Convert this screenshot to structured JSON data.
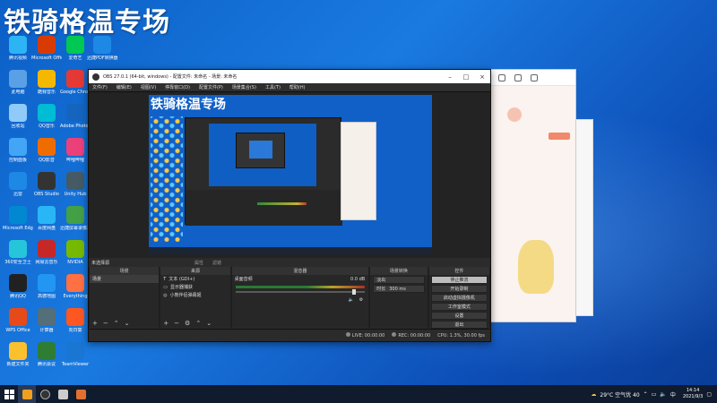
{
  "overlay_title": "铁骑格温专场",
  "desktop_icons": [
    {
      "label": "腾讯视频"
    },
    {
      "label": "Microsoft Office"
    },
    {
      "label": "爱奇艺"
    },
    {
      "label": "迅捷PDF转换器"
    },
    {
      "label": "此电脑"
    },
    {
      "label": "酷我音乐"
    },
    {
      "label": "Google Chrome"
    },
    {
      "label": ""
    },
    {
      "label": "回收站"
    },
    {
      "label": "QQ音乐"
    },
    {
      "label": "Adobe Photoshop"
    },
    {
      "label": ""
    },
    {
      "label": "控制面板"
    },
    {
      "label": "QQ影音"
    },
    {
      "label": "哔哩哔哩"
    },
    {
      "label": ""
    },
    {
      "label": "迅雷"
    },
    {
      "label": "OBS Studio"
    },
    {
      "label": "Unity Hub"
    },
    {
      "label": ""
    },
    {
      "label": "Microsoft Edge"
    },
    {
      "label": "百度网盘"
    },
    {
      "label": "迅捷屏幕录像工具"
    },
    {
      "label": ""
    },
    {
      "label": "360安全卫士"
    },
    {
      "label": "网易云音乐"
    },
    {
      "label": "NVIDIA"
    },
    {
      "label": ""
    },
    {
      "label": "腾讯QQ"
    },
    {
      "label": "高德地图"
    },
    {
      "label": "Everything"
    },
    {
      "label": ""
    },
    {
      "label": "WPS Office"
    },
    {
      "label": "计算器"
    },
    {
      "label": "向日葵"
    },
    {
      "label": ""
    },
    {
      "label": "新建文件夹"
    },
    {
      "label": "腾讯会议"
    },
    {
      "label": "TeamViewer"
    },
    {
      "label": ""
    }
  ],
  "obs": {
    "window_title": "OBS 27.0.1 (64-bit, windows) - 配置文件: 未命名 - 场景: 未命名",
    "menu": [
      "文件(F)",
      "编辑(E)",
      "视图(V)",
      "停靠窗口(D)",
      "配置文件(P)",
      "场景集合(S)",
      "工具(T)",
      "帮助(H)"
    ],
    "preview_title": "铁骑格温专场",
    "no_source_label": "未选择源",
    "properties_label": "属性",
    "filters_label": "滤镜",
    "scenes": {
      "title": "场景",
      "items": [
        "场景"
      ]
    },
    "sources": {
      "title": "来源",
      "items": [
        "文本 (GDI+)",
        "显示器捕获",
        "小熊伴侣弹幕姬"
      ]
    },
    "mixer": {
      "title": "混音器",
      "channel": "桌面音频",
      "db": "0.0 dB"
    },
    "transitions": {
      "title": "场景转换",
      "type": "淡出",
      "duration_label": "时长",
      "duration": "300 ms"
    },
    "controls": {
      "title": "控件",
      "buttons": [
        "停止推流",
        "开始录制",
        "启动虚拟摄像机",
        "工作室模式",
        "设置",
        "退出"
      ]
    },
    "status": {
      "dropped": "LIVE: 00:00:00",
      "rec": "REC: 00:00:00",
      "cpu": "CPU: 1.3%, 30.00 fps"
    }
  },
  "taskbar": {
    "weather": "29°C 空气优 40",
    "ime": "中",
    "time": "14:14",
    "date": "2021/9/3"
  }
}
